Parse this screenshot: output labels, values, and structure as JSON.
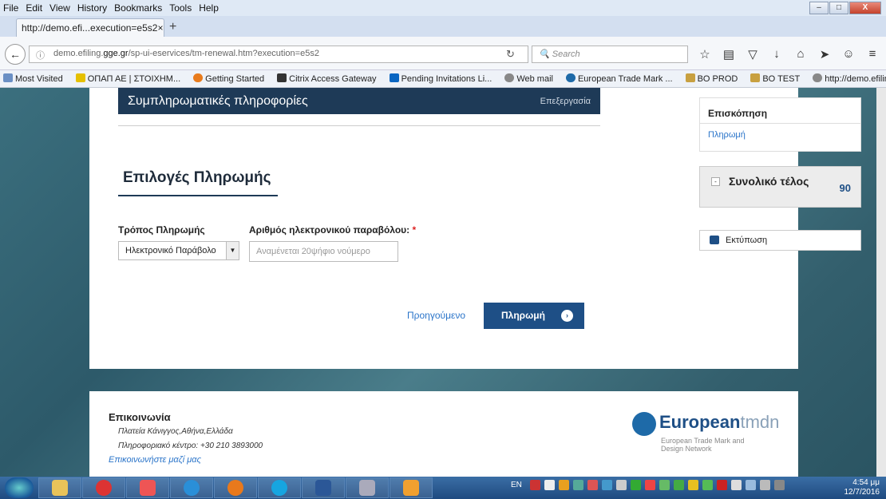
{
  "menu": [
    "File",
    "Edit",
    "View",
    "History",
    "Bookmarks",
    "Tools",
    "Help"
  ],
  "tab": {
    "title": "http://demo.efi...execution=e5s2",
    "close": "×",
    "new": "+"
  },
  "nav": {
    "url_pre": "demo.efiling.",
    "url_bold": "gge.gr",
    "url_post": "/sp-ui-eservices/tm-renewal.htm?execution=e5s2",
    "search_placeholder": "Search"
  },
  "bookmarks": [
    "Most Visited",
    "ΟΠΑΠ ΑΕ | ΣΤΟΙΧΗΜ...",
    "Getting Started",
    "Citrix Access Gateway",
    "Pending Invitations Li...",
    "Web mail",
    "European Trade Mark ...",
    "BO PROD",
    "BO TEST",
    "http://demo.efiling.gg..."
  ],
  "section": {
    "title": "Συμπληρωματικές πληροφορίες",
    "edit": "Επεξεργασία"
  },
  "payment": {
    "heading": "Επιλογές Πληρωμής",
    "method_label": "Τρόπος Πληρωμής",
    "method_value": "Ηλεκτρονικό Παράβολο",
    "number_label": "Αριθμός ηλεκτρονικού παραβόλου:",
    "required": "*",
    "number_placeholder": "Αναμένεται 20ψήφιο νούμερο",
    "prev": "Προηγούμενο",
    "pay": "Πληρωμή"
  },
  "sidebar": {
    "overview": "Επισκόπηση",
    "overview_link": "Πληρωμή",
    "total_label": "Συνολικό τέλος",
    "total_value": "90",
    "print": "Εκτύπωση"
  },
  "footer": {
    "heading": "Επικοινωνία",
    "address": "Πλατεία Κάνιγγος,Αθήνα,Ελλάδα",
    "phone": "Πληροφοριακό κέντρο: +30 210 3893000",
    "link": "Επικοινωνήστε μαζί μας",
    "logo_main": "European",
    "logo_accent": "tmdn",
    "logo_sub1": "European Trade Mark and",
    "logo_sub2": "Design Network"
  },
  "taskbar": {
    "lang": "EN",
    "time": "4:54 μμ",
    "date": "12/7/2016"
  },
  "colors": {
    "navy": "#1e3a57",
    "blue": "#1e4f86",
    "link": "#2a74c9"
  }
}
